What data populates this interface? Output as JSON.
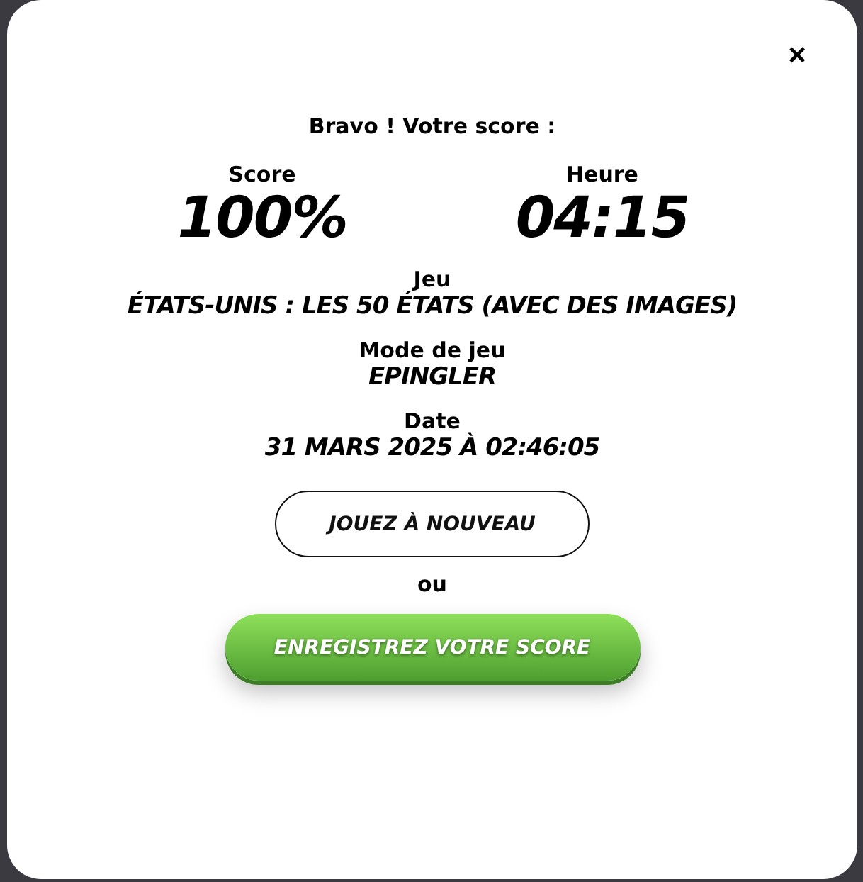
{
  "close_button": "×",
  "heading": "Bravo ! Votre score :",
  "stats": [
    {
      "label": "Score",
      "value": "100%"
    },
    {
      "label": "Heure",
      "value": "04:15"
    }
  ],
  "details": [
    {
      "label": "Jeu",
      "value": "ÉTATS-UNIS : LES 50 ÉTATS (AVEC DES IMAGES)"
    },
    {
      "label": "Mode de jeu",
      "value": "EPINGLER"
    },
    {
      "label": "Date",
      "value": "31 MARS 2025 À 02:46:05"
    }
  ],
  "play_again_button": "JOUEZ À NOUVEAU",
  "separator": "ou",
  "save_button": "ENREGISTREZ VOTRE SCORE"
}
